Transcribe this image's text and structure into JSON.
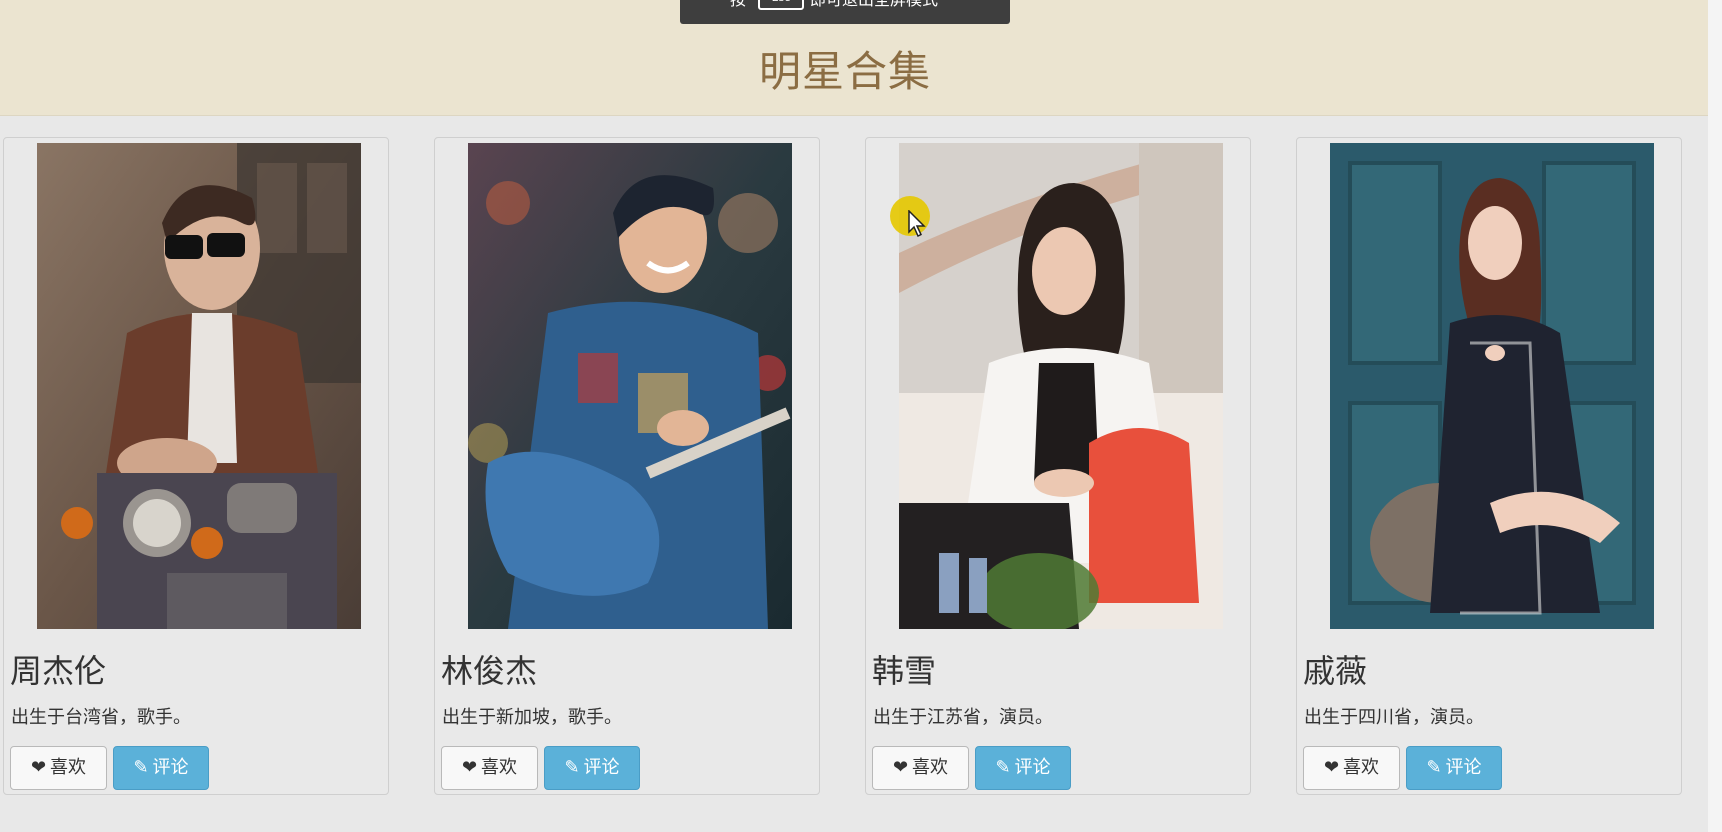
{
  "header": {
    "title": "明星合集"
  },
  "toast": {
    "prefix": "按",
    "key": "Esc",
    "suffix": "即可退出全屏模式"
  },
  "cards": [
    {
      "name": "周杰伦",
      "description": "出生于台湾省，歌手。",
      "like_label": "喜欢",
      "comment_label": "评论"
    },
    {
      "name": "林俊杰",
      "description": "出生于新加坡，歌手。",
      "like_label": "喜欢",
      "comment_label": "评论"
    },
    {
      "name": "韩雪",
      "description": "出生于江苏省，演员。",
      "like_label": "喜欢",
      "comment_label": "评论"
    },
    {
      "name": "戚薇",
      "description": "出生于四川省，演员。",
      "like_label": "喜欢",
      "comment_label": "评论"
    }
  ],
  "icons": {
    "like": "heart-icon",
    "comment": "pencil-icon"
  },
  "colors": {
    "header_bg": "#ebe4d0",
    "title": "#8b6d43",
    "comment_button": "#5bb1d9",
    "page_bg": "#e8e8e8"
  }
}
